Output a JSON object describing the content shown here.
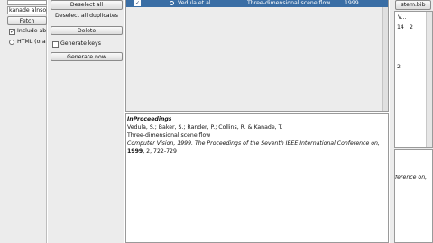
{
  "left": {
    "input1_value": "",
    "input2_value": "kanade alnso",
    "fetch_label": "Fetch",
    "include_label": "Include ab",
    "html_label": "HTML (ora"
  },
  "mid": {
    "deselect_all": "Deselect all",
    "deselect_duplicates": "Deselect all duplicates",
    "delete": "Delete",
    "generate_keys_label": "Generate keys",
    "generate_now": "Generate now"
  },
  "table": {
    "row": {
      "checked": "✓",
      "author": "Vedula et al.",
      "title": "Three-dimensional scene flow",
      "year": "1999"
    }
  },
  "preview": {
    "type": "InProceedings",
    "authors": "Vedula, S.; Baker, S.; Rander, P.; Collins, R. & Kanade, T.",
    "title": "Three-dimensional scene flow",
    "booktitle": "Computer Vision, 1999. The Proceedings of the Seventh IEEE International Conference on,",
    "year_bold": "1999",
    "pages": ", 2, 722-729"
  },
  "right": {
    "tab_label": "stem.bib",
    "col_header": "V...",
    "val1": "14",
    "val2": "2",
    "val3": "2",
    "snippet": "ference on,"
  },
  "colors": {
    "selection": "#3a6ea5",
    "panel_bg": "#e8e8e8",
    "border": "#9a9a9a"
  }
}
